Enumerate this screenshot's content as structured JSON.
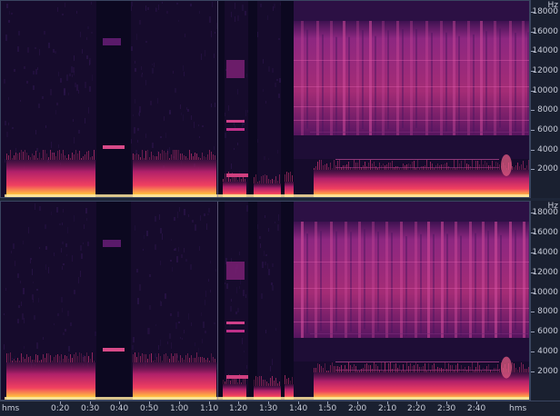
{
  "window": {
    "app": "Audio spectral frequency display"
  },
  "freq_axis": {
    "unit_label": "Hz",
    "ticks": [
      "18000",
      "16000",
      "14000",
      "12000",
      "10000",
      "8000",
      "6000",
      "4000",
      "2000"
    ]
  },
  "time_axis": {
    "left_unit": "hms",
    "right_unit": "hms",
    "ticks": [
      "0:20",
      "0:30",
      "0:40",
      "0:50",
      "1:00",
      "1:10",
      "1:20",
      "1:30",
      "1:40",
      "1:50",
      "2:00",
      "2:10",
      "2:20",
      "2:30",
      "2:40"
    ]
  },
  "channels": [
    {
      "id": "left-channel"
    },
    {
      "id": "right-channel"
    }
  ],
  "colors": {
    "background": "#120a26",
    "low_energy": "#2a0c4a",
    "mid_energy": "#8a1e7e",
    "high_energy": "#e0306a",
    "peak_energy": "#ffd050"
  }
}
